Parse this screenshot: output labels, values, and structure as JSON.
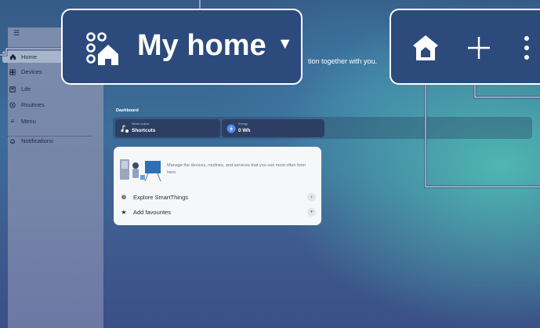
{
  "sidebar": {
    "items": [
      {
        "label": "Home",
        "icon": "home-icon",
        "active": true
      },
      {
        "label": "Devices",
        "icon": "devices-icon"
      },
      {
        "label": "Life",
        "icon": "life-icon"
      },
      {
        "label": "Routines",
        "icon": "routines-icon"
      },
      {
        "label": "Menu",
        "icon": "menu-icon"
      },
      {
        "label": "Notifications",
        "icon": "bell-icon"
      }
    ]
  },
  "header": {
    "location_title": "My home",
    "intro_text": "tion together with you."
  },
  "dashboard": {
    "label": "Dashboard",
    "tiles": [
      {
        "sub": "Media output",
        "main": "Shortcuts",
        "icon": "media-output-icon"
      },
      {
        "sub": "Energy",
        "main": "0 Wh",
        "icon": "energy-icon"
      }
    ]
  },
  "card": {
    "description": "Manage the devices, routines, and services that you use most often from here.",
    "rows": [
      {
        "label": "Explore SmartThings",
        "icon": "smartthings-icon",
        "action": "›"
      },
      {
        "label": "Add favourites",
        "icon": "star-icon",
        "action": "+"
      }
    ]
  },
  "colors": {
    "callout_bg": "#2c4b7c",
    "callout_border": "#ffffff",
    "sidebar_bg": "#7c8cac",
    "card_bg": "#f6f7f9"
  }
}
